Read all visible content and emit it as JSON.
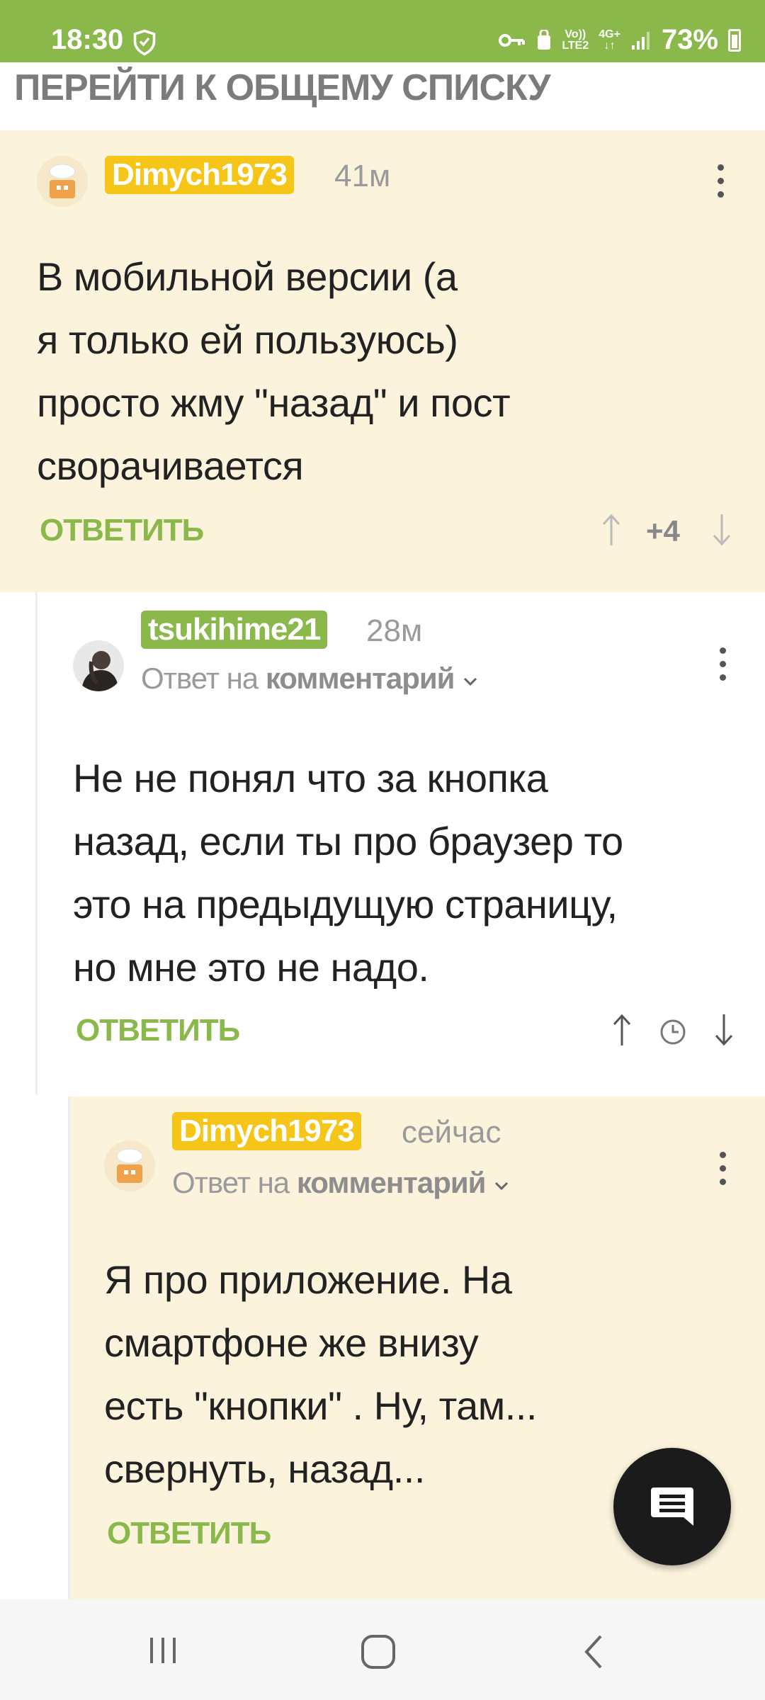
{
  "status_bar": {
    "time": "18:30",
    "net_top": "Vo))",
    "net_bottom": "LTE2",
    "net2_top": "4G+",
    "battery": "73%"
  },
  "header": {
    "back_to_list": "ПЕРЕЙТИ К ОБЩЕМУ СПИСКУ"
  },
  "comments": [
    {
      "username": "Dimych1973",
      "time": "41м",
      "lines": [
        "В мобильной версии (а",
        "я только ей пользуюсь)",
        "просто жму \"назад\" и пост",
        "сворачивается"
      ],
      "reply_label": "ОТВЕТИТЬ",
      "rating": "+4"
    },
    {
      "username": "tsukihime21",
      "time": "28м",
      "reply_to_prefix": "Ответ на",
      "reply_to_target": "комментарий",
      "lines": [
        "Не не понял что за кнопка",
        "назад, если ты про браузер то",
        "это на предыдущую страницу,",
        "но мне это не надо."
      ],
      "reply_label": "ОТВЕТИТЬ"
    },
    {
      "username": "Dimych1973",
      "time": "сейчас",
      "reply_to_prefix": "Ответ на",
      "reply_to_target": "комментарий",
      "lines": [
        "Я про приложение. На",
        "смартфоне же внизу",
        "есть \"кнопки\" . Ну, там...",
        "свернуть, назад..."
      ],
      "reply_label": "ОТВЕТИТЬ"
    }
  ],
  "colors": {
    "accent_green": "#8ab84a",
    "user_yellow": "#f5c518",
    "comment_bg": "#fcf3dc"
  },
  "icons": [
    "shield-icon",
    "key-icon",
    "signal-icon",
    "battery-icon",
    "more-vert-icon",
    "arrow-up-icon",
    "arrow-down-icon",
    "clock-icon",
    "chevron-down-icon",
    "comment-icon",
    "recents-icon",
    "home-icon",
    "back-icon"
  ]
}
